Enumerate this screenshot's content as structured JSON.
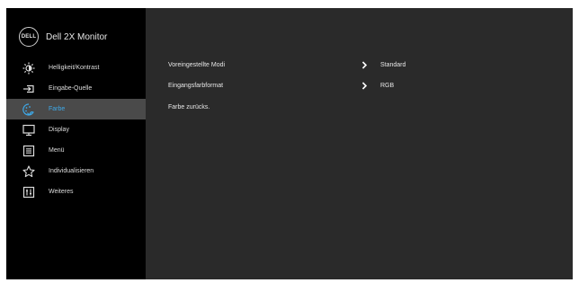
{
  "brand": {
    "logo_text": "DELL",
    "model": "Dell 2X Monitor"
  },
  "sidebar": {
    "items": [
      {
        "label": "Helligkeit/Kontrast",
        "icon": "brightness-icon",
        "active": false
      },
      {
        "label": "Eingabe-Quelle",
        "icon": "input-source-icon",
        "active": false
      },
      {
        "label": "Farbe",
        "icon": "color-palette-icon",
        "active": true
      },
      {
        "label": "Display",
        "icon": "display-icon",
        "active": false
      },
      {
        "label": "Menü",
        "icon": "menu-icon",
        "active": false
      },
      {
        "label": "Individualisieren",
        "icon": "star-icon",
        "active": false
      },
      {
        "label": "Weiteres",
        "icon": "others-icon",
        "active": false
      }
    ]
  },
  "content": {
    "rows": [
      {
        "name": "Voreingestellte Modi",
        "value": "Standard"
      },
      {
        "name": "Eingangsfarbformat",
        "value": "RGB"
      },
      {
        "name": "Farbe zurücks.",
        "value": ""
      }
    ]
  },
  "colors": {
    "accent": "#3ea9e8",
    "panel": "#2a2a2a",
    "sidebar": "#000000",
    "active_row": "#4a4a4a"
  }
}
